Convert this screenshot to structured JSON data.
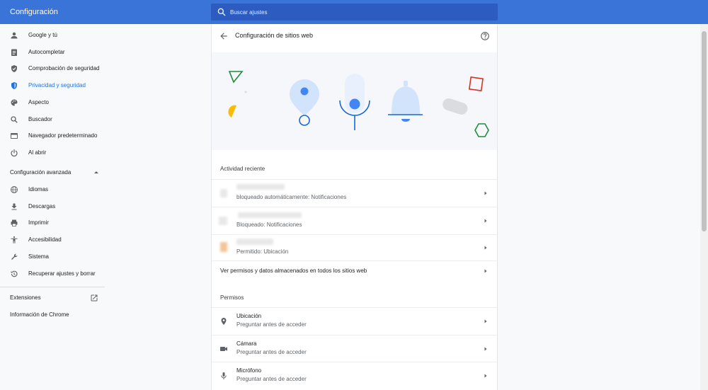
{
  "header": {
    "title": "Configuración",
    "search_placeholder": "Buscar ajustes"
  },
  "sidebar": {
    "items": [
      {
        "label": "Google y tú",
        "icon": "person-icon"
      },
      {
        "label": "Autocompletar",
        "icon": "clipboard-icon"
      },
      {
        "label": "Comprobación de seguridad",
        "icon": "shield-check-icon"
      },
      {
        "label": "Privacidad y seguridad",
        "icon": "shield-icon",
        "active": true
      },
      {
        "label": "Aspecto",
        "icon": "palette-icon"
      },
      {
        "label": "Buscador",
        "icon": "search-icon"
      },
      {
        "label": "Navegador predeterminado",
        "icon": "browser-icon"
      },
      {
        "label": "Al abrir",
        "icon": "power-icon"
      }
    ],
    "advanced_label": "Configuración avanzada",
    "advanced_items": [
      {
        "label": "Idiomas",
        "icon": "globe-icon"
      },
      {
        "label": "Descargas",
        "icon": "download-icon"
      },
      {
        "label": "Imprimir",
        "icon": "printer-icon"
      },
      {
        "label": "Accesibilidad",
        "icon": "accessibility-icon"
      },
      {
        "label": "Sistema",
        "icon": "wrench-icon"
      },
      {
        "label": "Recuperar ajustes y borrar",
        "icon": "restore-icon"
      }
    ],
    "extensions_label": "Extensiones",
    "about_label": "Información de Chrome"
  },
  "main": {
    "title": "Configuración de sitios web",
    "recent_activity_label": "Actividad reciente",
    "recent": [
      {
        "status": "bloqueado automáticamente: Notificaciones"
      },
      {
        "status": "Bloqueado: Notificaciones"
      },
      {
        "status": "Permitido: Ubicación"
      }
    ],
    "view_all_label": "Ver permisos y datos almacenados en todos los sitios web",
    "permissions_label": "Permisos",
    "permissions": [
      {
        "name": "Ubicación",
        "value": "Preguntar antes de acceder",
        "icon": "location-pin-icon"
      },
      {
        "name": "Cámara",
        "value": "Preguntar antes de acceder",
        "icon": "camera-icon"
      },
      {
        "name": "Micrófono",
        "value": "Preguntar antes de acceder",
        "icon": "microphone-icon"
      }
    ]
  },
  "colors": {
    "header_blue": "#3a74d9",
    "search_bg": "#2c5cbf",
    "accent": "#1a73e8"
  }
}
